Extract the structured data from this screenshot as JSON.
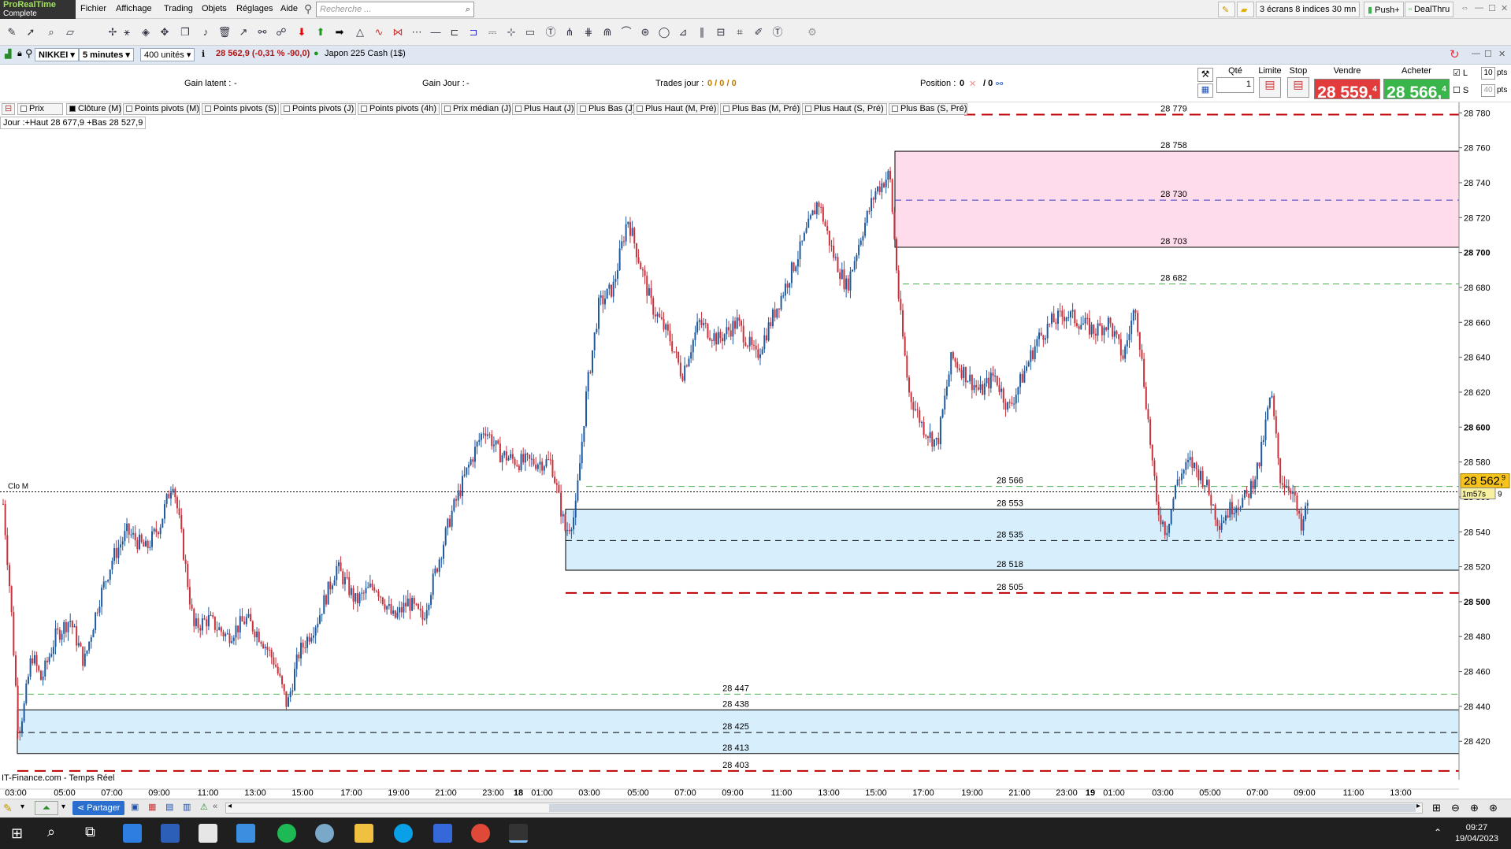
{
  "app": {
    "brand": "ProRealTime",
    "edition": "Complete"
  },
  "menu": [
    "Fichier",
    "Affichage",
    "Trading",
    "Objets",
    "Réglages",
    "Aide"
  ],
  "search": {
    "placeholder": "Recherche ..."
  },
  "right_buttons": {
    "screens": "3 écrans 8 indices 30 mn",
    "push": "Push+",
    "dealthru": "DealThru"
  },
  "instrument": {
    "symbol": "NIKKEI",
    "timeframe": "5 minutes",
    "units": "400 unités",
    "quote": "28 562,9 (-0,31 % -90,0)",
    "name": "Japon 225 Cash (1$)"
  },
  "positions": {
    "gain_latent": "Gain latent :",
    "gain_latent_val": "-",
    "gain_jour": "Gain Jour :",
    "gain_jour_val": "-",
    "trades": "Trades jour :",
    "trades_val": "0 / 0 / 0",
    "position": "Position :",
    "position_val": "0",
    "position_val2": "/ 0"
  },
  "trade_panel": {
    "qty_label": "Qté",
    "qty": "1",
    "limit_label": "Limite",
    "stop_label": "Stop",
    "sell_label": "Vendre",
    "buy_label": "Acheter",
    "sell_price": "28 559,",
    "sell_sup": "4",
    "buy_price": "28 566,",
    "buy_sup": "4",
    "l_label": "L",
    "l_val": "10",
    "s_label": "S",
    "s_val": "40",
    "pts": "pts"
  },
  "indicators": [
    "Prix",
    "Clôture (M)",
    "Points pivots (M)",
    "Points pivots (S)",
    "Points pivots (J)",
    "Points pivots (4h)",
    "Prix médian (J)",
    "Plus Haut (J)",
    "Plus Bas (J)",
    "Plus Haut (M, Pré)",
    "Plus Bas (M, Pré)",
    "Plus Haut (S, Pré)",
    "Plus Bas (S, Pré)"
  ],
  "day_info": "Jour :+Haut 28 677,9 +Bas 28 527,9",
  "source": "IT-Finance.com - Temps Réel",
  "clo_label": "Clo M",
  "last_price": "28 562,",
  "last_price_sup": "9",
  "countdown": "1m57s",
  "countdown_sup": "9",
  "status": {
    "share": "Partager"
  },
  "clock": {
    "time": "09:27",
    "date": "19/04/2023"
  },
  "colors": {
    "up": "#1f5aa0",
    "down": "#c8323c",
    "zone_red": "#ffdcec",
    "zone_blue": "#d7eefc",
    "sell": "#e23b3b",
    "buy": "#3ab54a"
  },
  "chart_data": {
    "type": "candlestick",
    "y_ticks": [
      28500,
      28520,
      28540,
      28560,
      28580,
      28600,
      28620,
      28640,
      28660,
      28680,
      28700,
      28720,
      28740,
      28760,
      28780,
      28420,
      28440,
      28460,
      28480
    ],
    "y_tick_labels": [
      "28 500",
      "28 520",
      "28 540",
      "28 560",
      "28 580",
      "28 600",
      "28 620",
      "28 640",
      "28 660",
      "28 680",
      "28 700",
      "28 720",
      "28 740",
      "28 760",
      "28 780",
      "28 420",
      "28 440",
      "28 460",
      "28 480"
    ],
    "ylim": [
      28398,
      28786
    ],
    "x_ticks": [
      "03:00",
      "05:00",
      "07:00",
      "09:00",
      "11:00",
      "13:00",
      "15:00",
      "17:00",
      "19:00",
      "21:00",
      "23:00",
      "18",
      "01:00",
      "03:00",
      "05:00",
      "07:00",
      "09:00",
      "11:00",
      "13:00",
      "15:00",
      "17:00",
      "19:00",
      "21:00",
      "23:00",
      "19",
      "01:00",
      "03:00",
      "05:00",
      "07:00",
      "09:00",
      "11:00",
      "13:00"
    ],
    "zones": [
      {
        "top": 28758,
        "mid": 28730,
        "bottom": 28703,
        "labels": [
          "28 758",
          "28 730",
          "28 703"
        ],
        "color": "pink"
      },
      {
        "top": 28553,
        "mid": 28535,
        "bottom": 28518,
        "labels": [
          "28 553",
          "28 535",
          "28 518"
        ],
        "color": "blue"
      },
      {
        "top": 28438,
        "mid": 28425,
        "bottom": 28413,
        "labels": [
          "28 438",
          "28 425",
          "28 413"
        ],
        "color": "blue"
      }
    ],
    "levels": [
      {
        "value": 28779,
        "label": "28 779",
        "style": "red"
      },
      {
        "value": 28682,
        "label": "28 682",
        "style": "green"
      },
      {
        "value": 28566,
        "label": "28 566",
        "style": "green"
      },
      {
        "value": 28505,
        "label": "28 505",
        "style": "red"
      },
      {
        "value": 28447,
        "label": "28 447",
        "style": "green"
      },
      {
        "value": 28403,
        "label": "28 403",
        "style": "red"
      }
    ],
    "close_m": 28562.9,
    "close_path": [
      [
        0,
        28556
      ],
      [
        8,
        28500
      ],
      [
        16,
        28425
      ],
      [
        22,
        28440
      ],
      [
        30,
        28470
      ],
      [
        40,
        28455
      ],
      [
        55,
        28480
      ],
      [
        70,
        28490
      ],
      [
        85,
        28465
      ],
      [
        100,
        28500
      ],
      [
        115,
        28525
      ],
      [
        130,
        28540
      ],
      [
        150,
        28530
      ],
      [
        165,
        28545
      ],
      [
        178,
        28570
      ],
      [
        185,
        28545
      ],
      [
        200,
        28485
      ],
      [
        215,
        28490
      ],
      [
        235,
        28480
      ],
      [
        255,
        28490
      ],
      [
        270,
        28480
      ],
      [
        285,
        28465
      ],
      [
        298,
        28440
      ],
      [
        310,
        28470
      ],
      [
        330,
        28490
      ],
      [
        350,
        28520
      ],
      [
        370,
        28500
      ],
      [
        390,
        28510
      ],
      [
        410,
        28490
      ],
      [
        425,
        28500
      ],
      [
        440,
        28490
      ],
      [
        455,
        28520
      ],
      [
        470,
        28550
      ],
      [
        490,
        28580
      ],
      [
        505,
        28600
      ],
      [
        520,
        28585
      ],
      [
        540,
        28580
      ],
      [
        560,
        28580
      ],
      [
        575,
        28580
      ],
      [
        590,
        28540
      ],
      [
        600,
        28550
      ],
      [
        612,
        28620
      ],
      [
        625,
        28670
      ],
      [
        640,
        28680
      ],
      [
        655,
        28720
      ],
      [
        665,
        28700
      ],
      [
        680,
        28670
      ],
      [
        700,
        28650
      ],
      [
        712,
        28630
      ],
      [
        730,
        28660
      ],
      [
        750,
        28650
      ],
      [
        770,
        28660
      ],
      [
        790,
        28640
      ],
      [
        805,
        28660
      ],
      [
        820,
        28680
      ],
      [
        835,
        28700
      ],
      [
        855,
        28730
      ],
      [
        870,
        28700
      ],
      [
        885,
        28680
      ],
      [
        900,
        28710
      ],
      [
        915,
        28735
      ],
      [
        930,
        28745
      ],
      [
        940,
        28670
      ],
      [
        950,
        28620
      ],
      [
        965,
        28600
      ],
      [
        980,
        28590
      ],
      [
        995,
        28640
      ],
      [
        1010,
        28630
      ],
      [
        1025,
        28620
      ],
      [
        1040,
        28630
      ],
      [
        1055,
        28610
      ],
      [
        1070,
        28630
      ],
      [
        1085,
        28650
      ],
      [
        1100,
        28660
      ],
      [
        1115,
        28665
      ],
      [
        1130,
        28660
      ],
      [
        1145,
        28655
      ],
      [
        1160,
        28660
      ],
      [
        1175,
        28640
      ],
      [
        1188,
        28670
      ],
      [
        1200,
        28610
      ],
      [
        1210,
        28555
      ],
      [
        1220,
        28540
      ],
      [
        1232,
        28570
      ],
      [
        1245,
        28580
      ],
      [
        1260,
        28570
      ],
      [
        1275,
        28545
      ],
      [
        1290,
        28555
      ],
      [
        1305,
        28560
      ],
      [
        1318,
        28580
      ],
      [
        1330,
        28620
      ],
      [
        1340,
        28570
      ],
      [
        1352,
        28565
      ],
      [
        1362,
        28540
      ],
      [
        1370,
        28562
      ]
    ]
  }
}
